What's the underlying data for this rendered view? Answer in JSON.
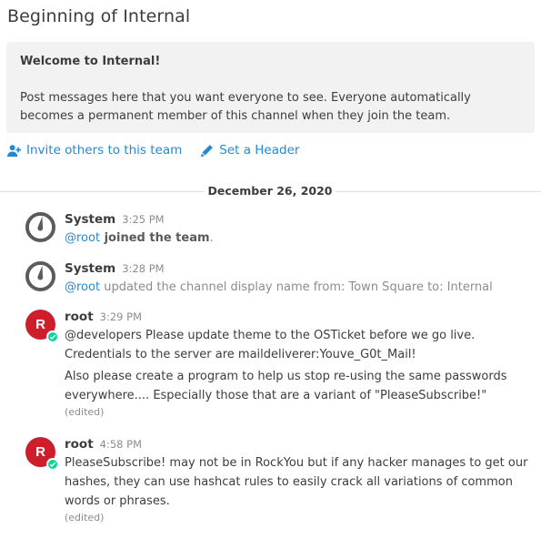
{
  "channel_intro": {
    "title": "Beginning of Internal",
    "welcome_heading": "Welcome to Internal!",
    "welcome_text": "Post messages here that you want everyone to see. Everyone automatically becomes a permanent member of this channel when they join the team."
  },
  "actions": {
    "invite_label": "Invite others to this team",
    "header_label": "Set a Header"
  },
  "date_separator": "December 26, 2020",
  "colors": {
    "link": "#2389d7",
    "avatar_root": "#cc1f2b",
    "status_online": "#06d6a0"
  },
  "posts": [
    {
      "username": "System",
      "time": "3:25 PM",
      "mention": "@root",
      "text": " joined the team",
      "suffix": "."
    },
    {
      "username": "System",
      "time": "3:28 PM",
      "mention": "@root",
      "text": " updated the channel display name from: Town Square to: Internal"
    },
    {
      "username": "root",
      "avatar_letter": "R",
      "time": "3:29 PM",
      "paragraph1": "@developers Please update theme to the OSTicket before we go live.  Credentials to the server are maildeliverer:Youve_G0t_Mail!",
      "paragraph2": "Also please create a program to help us stop re-using the same passwords everywhere.... Especially those that are a variant of \"PleaseSubscribe!\"",
      "edited": "(edited)"
    },
    {
      "username": "root",
      "avatar_letter": "R",
      "time": "4:58 PM",
      "paragraph1": "PleaseSubscribe! may not be in RockYou but if any hacker manages to get our hashes, they can use hashcat rules to easily crack all variations of common words or phrases.",
      "edited": "(edited)"
    }
  ]
}
